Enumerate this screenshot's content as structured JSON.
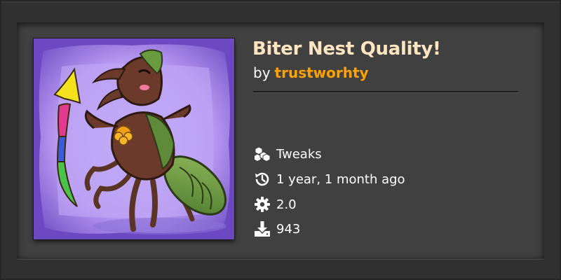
{
  "mod": {
    "title": "Biter Nest Quality!",
    "by_label": "by",
    "author": "trustworhty",
    "category": "Tweaks",
    "updated": "1 year, 1 month ago",
    "factorio_version": "2.0",
    "downloads": "943"
  },
  "icons": {
    "category": "cubes-icon",
    "updated": "history-icon",
    "version": "gear-icon",
    "downloads": "download-icon"
  },
  "colors": {
    "title": "#ffe6c0",
    "author": "#ffa200",
    "card_background": "#414040",
    "thumbnail_background": "#b89af2"
  }
}
